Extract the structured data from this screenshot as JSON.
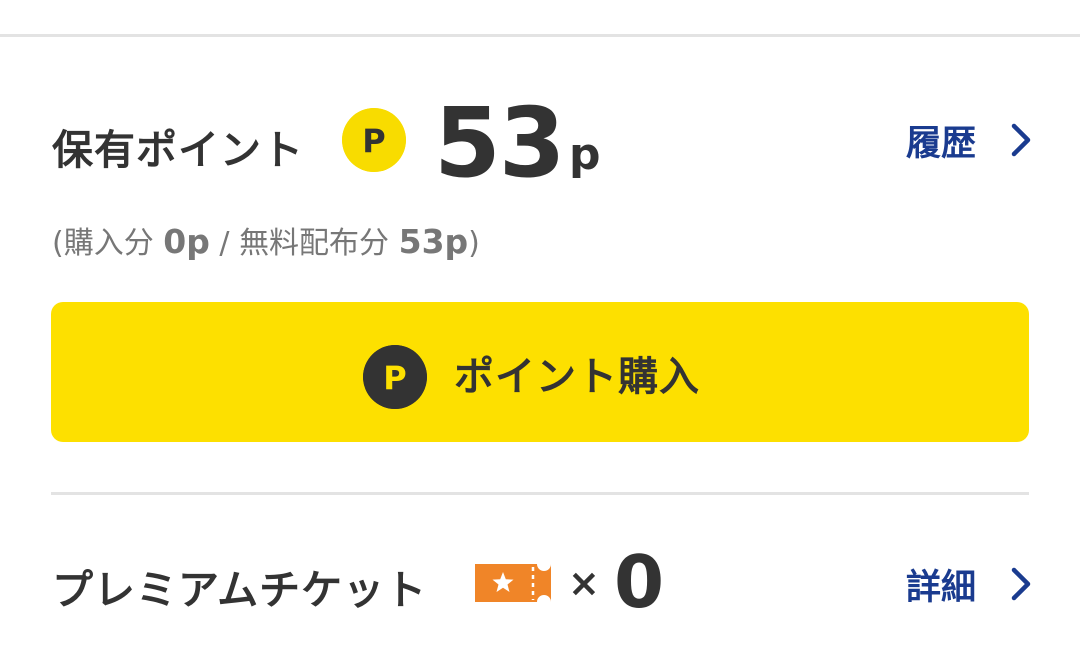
{
  "points": {
    "label": "保有ポイント",
    "coin_letter": "P",
    "value": "53",
    "unit": "p",
    "history_label": "履歴"
  },
  "breakdown": {
    "open_paren": "(",
    "purchased_label": "購入分",
    "purchased_value": "0p",
    "separator": "/",
    "free_label": "無料配布分",
    "free_value": "53p",
    "close_paren": ")"
  },
  "buy_button": {
    "coin_letter": "P",
    "label": "ポイント購入"
  },
  "ticket": {
    "label": "プレミアムチケット",
    "times": "×",
    "count": "0",
    "detail_label": "詳細"
  },
  "colors": {
    "accent_yellow": "#fde000",
    "coin_yellow": "#f8dc00",
    "link_blue": "#1a3b8f",
    "ticket_orange": "#f08528",
    "text_dark": "#333333",
    "text_gray": "#777777",
    "divider": "#e3e3e3"
  },
  "icons": {
    "points_coin": "p-coin-icon",
    "history_chevron": "chevron-right-icon",
    "buy_coin": "p-coin-icon",
    "ticket": "premium-ticket-icon",
    "detail_chevron": "chevron-right-icon"
  }
}
